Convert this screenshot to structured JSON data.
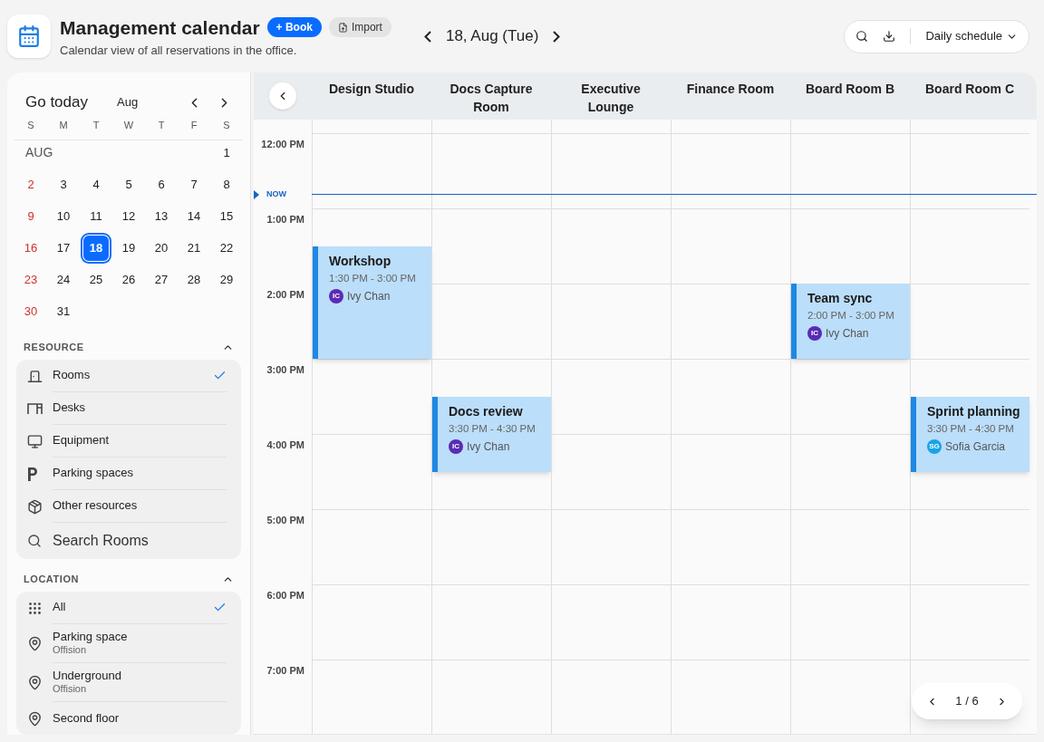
{
  "header": {
    "title": "Management calendar",
    "subtitle": "Calendar view of all reservations in the office.",
    "book_button": "+ Book",
    "import_button": "Import",
    "date": "18, Aug (Tue)",
    "view_select": "Daily schedule"
  },
  "mini_calendar": {
    "go_today": "Go today",
    "month": "Aug",
    "weekdays": [
      "S",
      "M",
      "T",
      "W",
      "T",
      "F",
      "S"
    ],
    "month_label": "AUG",
    "weeks": [
      [
        {
          "day": "1",
          "selected": false
        }
      ],
      [
        {
          "day": "2",
          "selected": false
        },
        {
          "day": "3",
          "selected": false
        },
        {
          "day": "4",
          "selected": false
        },
        {
          "day": "5",
          "selected": false
        },
        {
          "day": "6",
          "selected": false
        },
        {
          "day": "7",
          "selected": false
        },
        {
          "day": "8",
          "selected": false
        }
      ],
      [
        {
          "day": "9",
          "selected": false
        },
        {
          "day": "10",
          "selected": false
        },
        {
          "day": "11",
          "selected": false
        },
        {
          "day": "12",
          "selected": false
        },
        {
          "day": "13",
          "selected": false
        },
        {
          "day": "14",
          "selected": false
        },
        {
          "day": "15",
          "selected": false
        }
      ],
      [
        {
          "day": "16",
          "selected": false
        },
        {
          "day": "17",
          "selected": false
        },
        {
          "day": "18",
          "selected": true
        },
        {
          "day": "19",
          "selected": false
        },
        {
          "day": "20",
          "selected": false
        },
        {
          "day": "21",
          "selected": false
        },
        {
          "day": "22",
          "selected": false
        }
      ],
      [
        {
          "day": "23",
          "selected": false
        },
        {
          "day": "24",
          "selected": false
        },
        {
          "day": "25",
          "selected": false
        },
        {
          "day": "26",
          "selected": false
        },
        {
          "day": "27",
          "selected": false
        },
        {
          "day": "28",
          "selected": false
        },
        {
          "day": "29",
          "selected": false
        }
      ],
      [
        {
          "day": "30",
          "selected": false
        },
        {
          "day": "31",
          "selected": false
        }
      ]
    ]
  },
  "resource": {
    "heading": "RESOURCE",
    "expanded": true,
    "items": [
      {
        "kind": "room",
        "label": "Rooms",
        "selected": true
      },
      {
        "kind": "desk",
        "label": "Desks",
        "selected": false
      },
      {
        "kind": "equipment",
        "label": "Equipment",
        "selected": false
      },
      {
        "kind": "parking",
        "label": "Parking spaces",
        "selected": false
      },
      {
        "kind": "other",
        "label": "Other resources",
        "selected": false
      }
    ],
    "search": "Search Rooms"
  },
  "location": {
    "heading": "LOCATION",
    "expanded": true,
    "items": [
      {
        "kind": "all",
        "label": "All",
        "selected": true
      },
      {
        "kind": "place",
        "label": "Parking space",
        "sublabel": "Offision",
        "selected": false
      },
      {
        "kind": "place",
        "label": "Underground",
        "sublabel": "Offision",
        "selected": false
      },
      {
        "kind": "place",
        "label": "Second floor",
        "selected": false
      }
    ]
  },
  "schedule": {
    "now_label": "NOW",
    "times": [
      "12:00 PM",
      "1:00 PM",
      "2:00 PM",
      "3:00 PM",
      "4:00 PM",
      "5:00 PM",
      "6:00 PM",
      "7:00 PM"
    ],
    "columns": [
      {
        "name": "Design Studio",
        "events": [
          {
            "title": "Workshop",
            "time": "1:30 PM - 3:00 PM",
            "person": "Ivy Chan",
            "initials": "IC",
            "color": "#5b2bb5"
          }
        ]
      },
      {
        "name": "Docs Capture Room",
        "events": [
          {
            "title": "Docs review",
            "time": "3:30 PM - 4:30 PM",
            "person": "Ivy Chan",
            "initials": "IC",
            "color": "#5b2bb5"
          }
        ]
      },
      {
        "name": "Executive Lounge"
      },
      {
        "name": "Finance Room"
      },
      {
        "name": "Board Room B",
        "events": [
          {
            "title": "Team sync",
            "time": "2:00 PM - 3:00 PM",
            "person": "Ivy Chan",
            "initials": "IC",
            "color": "#5b2bb5"
          }
        ]
      },
      {
        "name": "Board Room C",
        "events": [
          {
            "title": "Sprint planning",
            "time": "3:30 PM - 4:30 PM",
            "person": "Sofia Garcia",
            "initials": "SG",
            "color": "#1aa3e8"
          }
        ]
      }
    ],
    "pager": "1 / 6"
  }
}
